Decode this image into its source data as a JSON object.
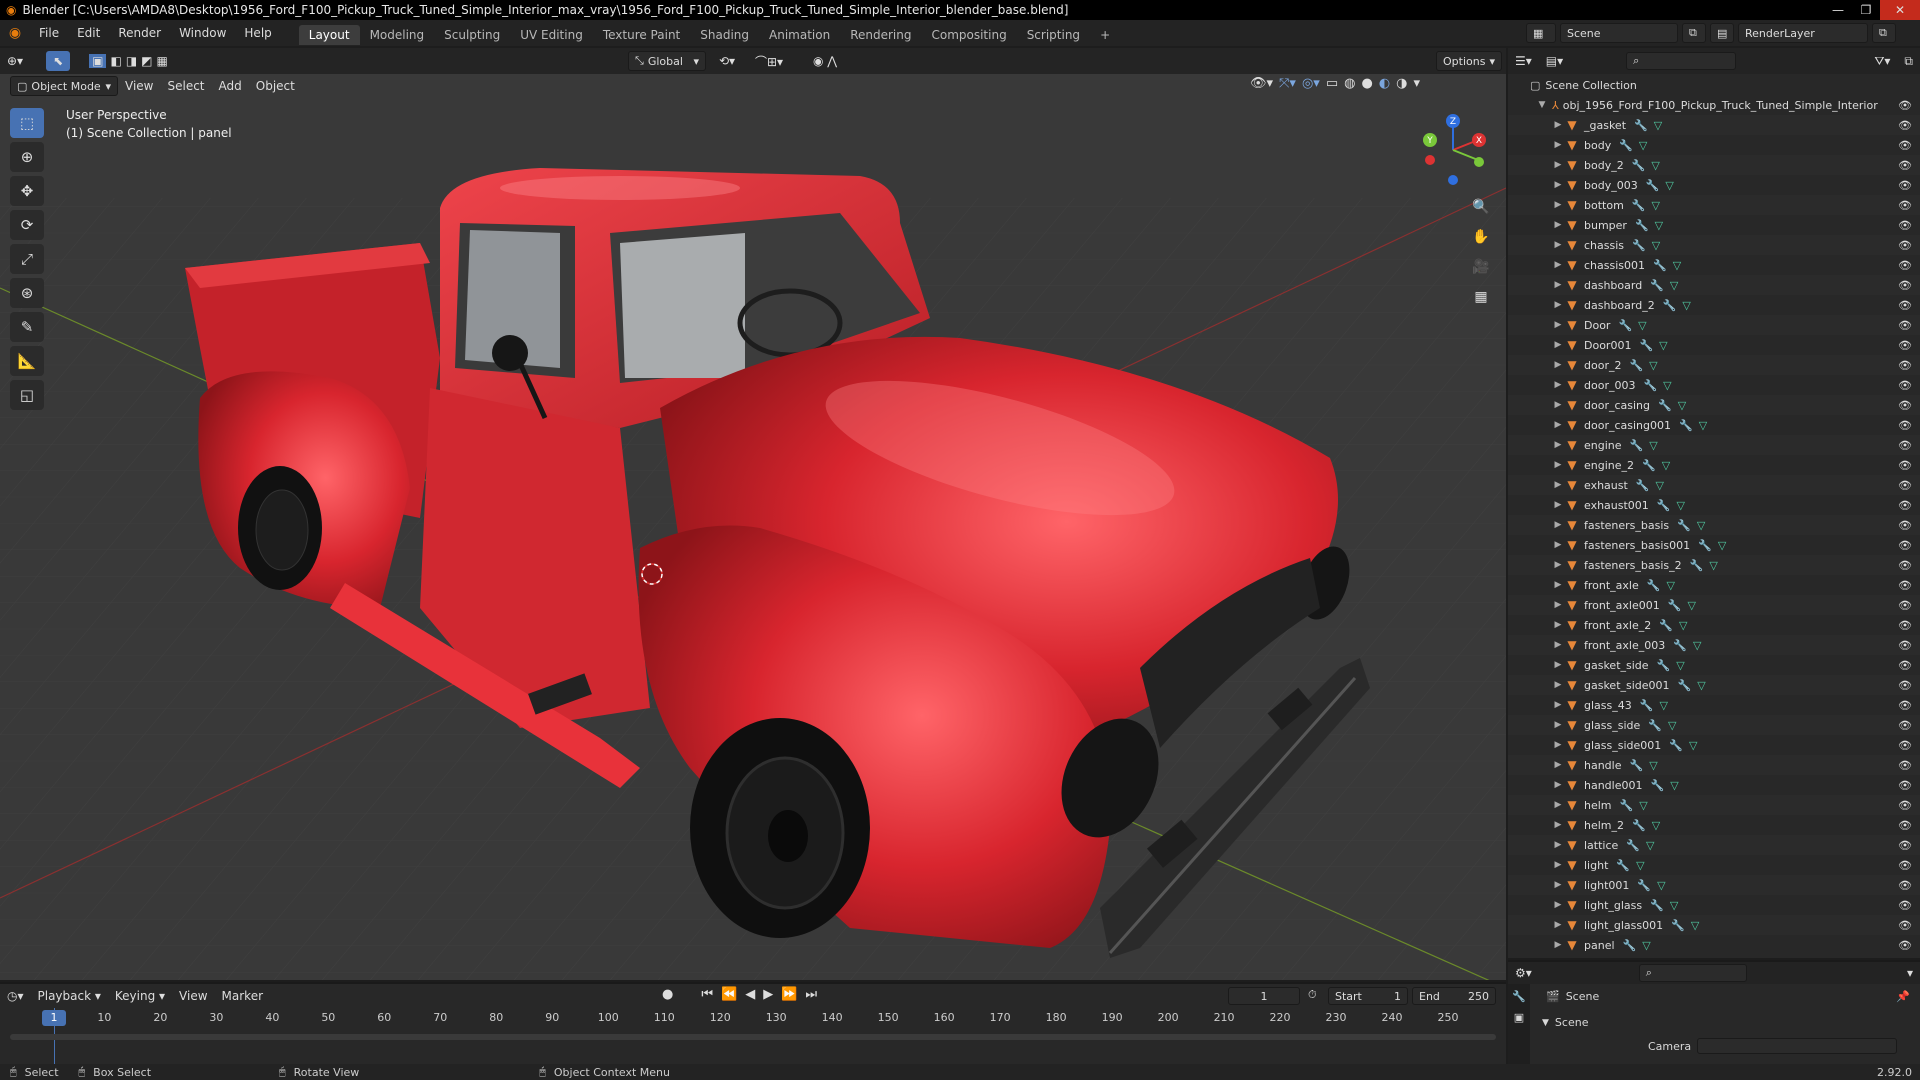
{
  "title": "Blender [C:\\Users\\AMDA8\\Desktop\\1956_Ford_F100_Pickup_Truck_Tuned_Simple_Interior_max_vray\\1956_Ford_F100_Pickup_Truck_Tuned_Simple_Interior_blender_base.blend]",
  "menu": [
    "File",
    "Edit",
    "Render",
    "Window",
    "Help"
  ],
  "workspaces": [
    "Layout",
    "Modeling",
    "Sculpting",
    "UV Editing",
    "Texture Paint",
    "Shading",
    "Animation",
    "Rendering",
    "Compositing",
    "Scripting"
  ],
  "active_workspace": "Layout",
  "scene_name": "Scene",
  "render_layer": "RenderLayer",
  "viewport": {
    "mode": "Object Mode",
    "menus": [
      "View",
      "Select",
      "Add",
      "Object"
    ],
    "transform_orientation": "Global",
    "options": "Options",
    "info_line1": "User Perspective",
    "info_line2": "(1) Scene Collection | panel"
  },
  "gizmo": {
    "x": "X",
    "y": "Y",
    "z": "Z"
  },
  "outliner": {
    "root": "Scene Collection",
    "collection": "obj_1956_Ford_F100_Pickup_Truck_Tuned_Simple_Interior",
    "items": [
      "_gasket",
      "body",
      "body_2",
      "body_003",
      "bottom",
      "bumper",
      "chassis",
      "chassis001",
      "dashboard",
      "dashboard_2",
      "Door",
      "Door001",
      "door_2",
      "door_003",
      "door_casing",
      "door_casing001",
      "engine",
      "engine_2",
      "exhaust",
      "exhaust001",
      "fasteners_basis",
      "fasteners_basis001",
      "fasteners_basis_2",
      "front_axle",
      "front_axle001",
      "front_axle_2",
      "front_axle_003",
      "gasket_side",
      "gasket_side001",
      "glass_43",
      "glass_side",
      "glass_side001",
      "handle",
      "handle001",
      "helm",
      "helm_2",
      "lattice",
      "light",
      "light001",
      "light_glass",
      "light_glass001",
      "panel"
    ]
  },
  "properties": {
    "scene": "Scene",
    "section": "Scene",
    "field": "Camera"
  },
  "timeline": {
    "menus": [
      "Playback",
      "Keying",
      "View",
      "Marker"
    ],
    "current_frame": "1",
    "start_label": "Start",
    "start": "1",
    "end_label": "End",
    "end": "250",
    "ticks": [
      "1",
      "10",
      "20",
      "30",
      "40",
      "50",
      "60",
      "70",
      "80",
      "90",
      "100",
      "110",
      "120",
      "130",
      "140",
      "150",
      "160",
      "170",
      "180",
      "190",
      "200",
      "210",
      "220",
      "230",
      "240",
      "250"
    ]
  },
  "status": {
    "select": "Select",
    "box_select": "Box Select",
    "rotate": "Rotate View",
    "context": "Object Context Menu",
    "version": "2.92.0"
  },
  "colors": {
    "truck": "#d8252e",
    "accent": "#4772b3",
    "object_icon": "#e8883a"
  }
}
